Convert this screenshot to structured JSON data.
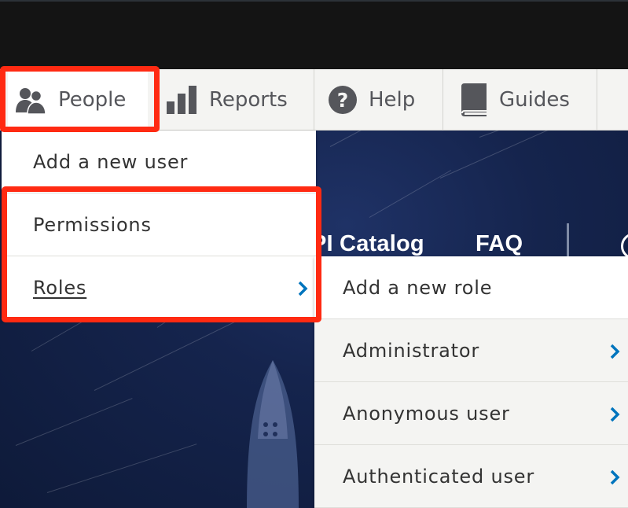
{
  "toolbar": {
    "items": [
      {
        "label": "People",
        "icon": "people-icon"
      },
      {
        "label": "Reports",
        "icon": "bar-chart-icon"
      },
      {
        "label": "Help",
        "icon": "question-circle-icon"
      },
      {
        "label": "Guides",
        "icon": "book-icon"
      }
    ]
  },
  "people_menu": {
    "items": [
      {
        "label": "Add a new user"
      },
      {
        "label": "Permissions"
      },
      {
        "label": "Roles",
        "has_submenu": true
      }
    ]
  },
  "roles_submenu": {
    "items": [
      {
        "label": "Add a new role"
      },
      {
        "label": "Administrator",
        "has_submenu": true
      },
      {
        "label": "Anonymous user",
        "has_submenu": true
      },
      {
        "label": "Authenticated user",
        "has_submenu": true
      }
    ]
  },
  "site_nav": {
    "items": [
      "PI Catalog",
      "FAQ"
    ]
  },
  "colors": {
    "highlight": "#ff2a12",
    "chevron": "#0074bd",
    "toolbar_bg": "#f4f4f2",
    "icon_gray": "#55565b",
    "hero_bg": "#15244d"
  }
}
